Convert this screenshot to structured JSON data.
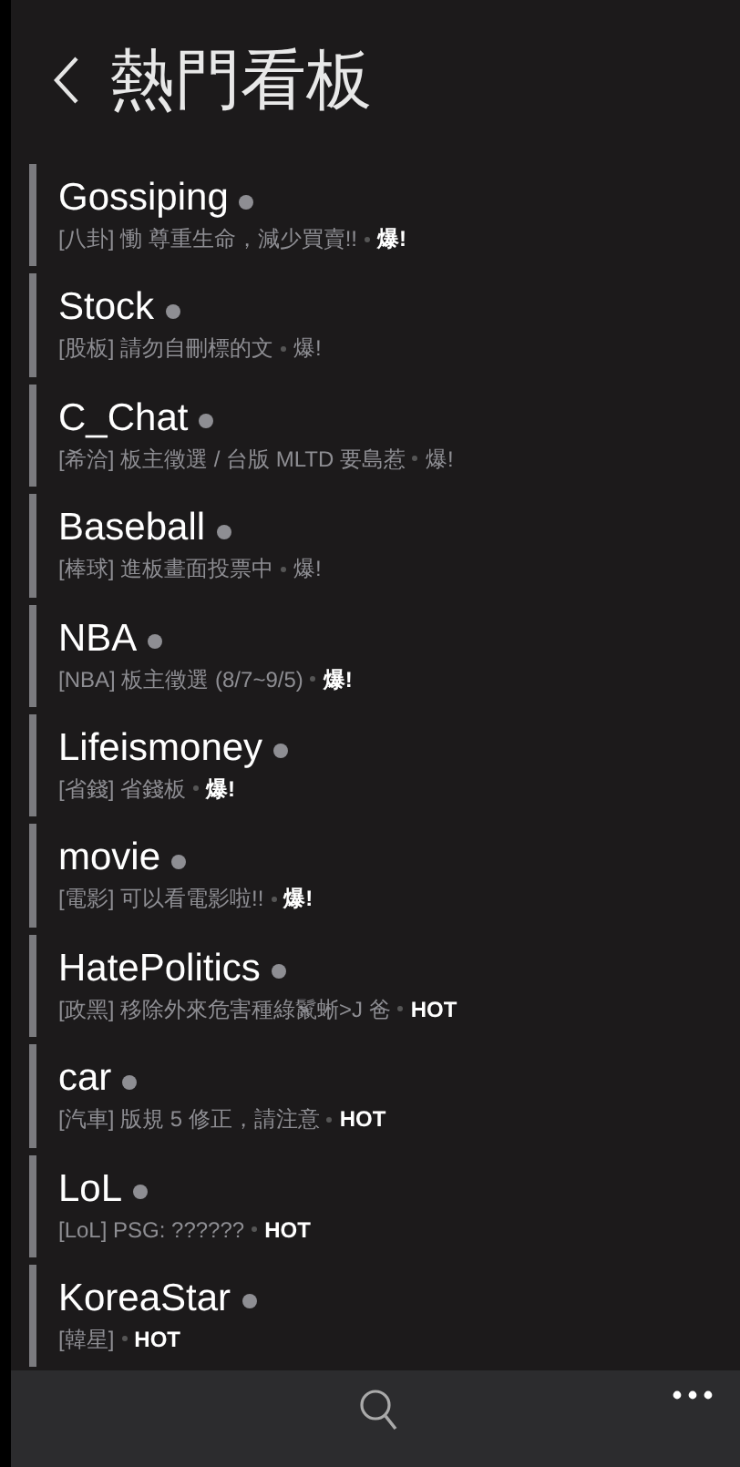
{
  "header": {
    "title": "熱門看板"
  },
  "boards": [
    {
      "name": "Gossiping",
      "subtitle": "[八卦] 慟 尊重生命，減少買賣!!",
      "badge": "爆!",
      "emphasized": true
    },
    {
      "name": "Stock",
      "subtitle": "[股板] 請勿自刪標的文",
      "badge": "爆!",
      "emphasized": false
    },
    {
      "name": "C_Chat",
      "subtitle": "[希洽] 板主徵選 / 台版 MLTD 要島惹",
      "badge": "爆!",
      "emphasized": false
    },
    {
      "name": "Baseball",
      "subtitle": "[棒球] 進板畫面投票中",
      "badge": "爆!",
      "emphasized": false
    },
    {
      "name": "NBA",
      "subtitle": "[NBA] 板主徵選 (8/7~9/5)",
      "badge": "爆!",
      "emphasized": true
    },
    {
      "name": "Lifeismoney",
      "subtitle": "[省錢] 省錢板",
      "badge": "爆!",
      "emphasized": true
    },
    {
      "name": "movie",
      "subtitle": "[電影] 可以看電影啦!!",
      "badge": "爆!",
      "emphasized": true
    },
    {
      "name": "HatePolitics",
      "subtitle": "[政黑] 移除外來危害種綠鬣蜥>J 爸",
      "badge": "HOT",
      "emphasized": true
    },
    {
      "name": "car",
      "subtitle": "[汽車] 版規 5 修正，請注意",
      "badge": "HOT",
      "emphasized": true
    },
    {
      "name": "LoL",
      "subtitle": "[LoL] PSG: ??????",
      "badge": "HOT",
      "emphasized": true
    },
    {
      "name": "KoreaStar",
      "subtitle": "[韓星]",
      "badge": "HOT",
      "emphasized": true
    }
  ]
}
